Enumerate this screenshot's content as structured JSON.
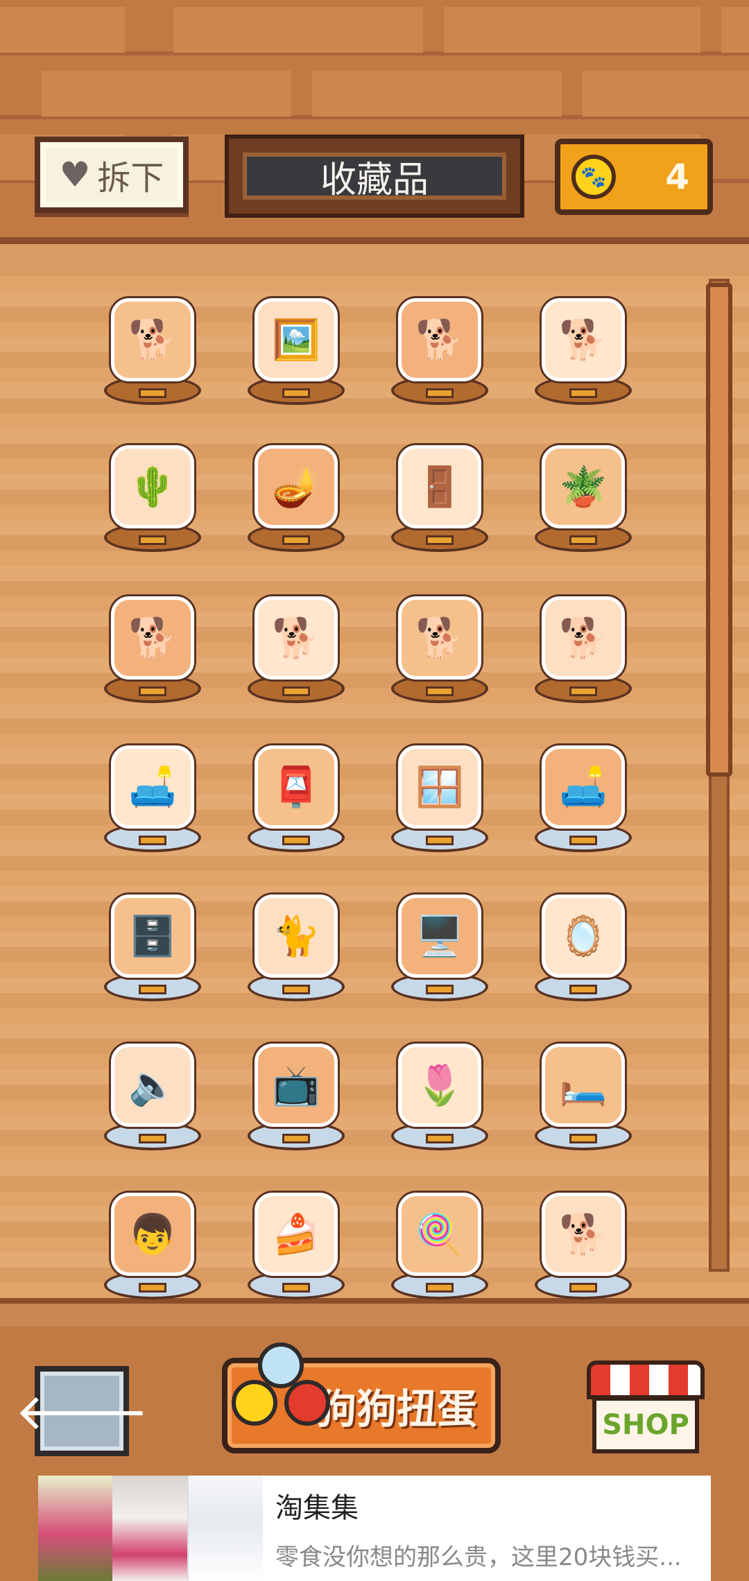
{
  "header": {
    "remove_label": "拆下",
    "title": "收藏品",
    "coin_count": "4"
  },
  "collection": {
    "rows": [
      [
        {
          "name": "shiba-figure",
          "icon": "🐕",
          "base": "wood"
        },
        {
          "name": "framed-cat-picture",
          "icon": "🖼️",
          "base": "wood"
        },
        {
          "name": "shiba-sitting",
          "icon": "🐕",
          "base": "wood"
        },
        {
          "name": "shiba-with-bowl",
          "icon": "🐕",
          "base": "wood"
        }
      ],
      [
        {
          "name": "shiba-with-cactus",
          "icon": "🌵",
          "base": "wood"
        },
        {
          "name": "floor-lamp",
          "icon": "🪔",
          "base": "wood"
        },
        {
          "name": "wardrobe",
          "icon": "🚪",
          "base": "wood"
        },
        {
          "name": "potted-plant-stool",
          "icon": "🪴",
          "base": "wood"
        }
      ],
      [
        {
          "name": "shiba-sleeping",
          "icon": "🐕",
          "base": "wood"
        },
        {
          "name": "shiba-with-hat",
          "icon": "🐕",
          "base": "wood"
        },
        {
          "name": "shiba-bow",
          "icon": "🐕",
          "base": "wood"
        },
        {
          "name": "shiba-with-box",
          "icon": "🐕",
          "base": "wood"
        }
      ],
      [
        {
          "name": "shiba-on-armchair",
          "icon": "🛋️",
          "base": "glass"
        },
        {
          "name": "shiba-with-mailbox",
          "icon": "📮",
          "base": "glass"
        },
        {
          "name": "round-window",
          "icon": "🪟",
          "base": "glass"
        },
        {
          "name": "shiba-on-sofa",
          "icon": "🛋️",
          "base": "glass"
        }
      ],
      [
        {
          "name": "tv-cabinet",
          "icon": "🗄️",
          "base": "glass"
        },
        {
          "name": "green-cat",
          "icon": "🐈",
          "base": "glass"
        },
        {
          "name": "computer-monitor",
          "icon": "🖥️",
          "base": "glass"
        },
        {
          "name": "oval-mirror",
          "icon": "🪞",
          "base": "glass"
        }
      ],
      [
        {
          "name": "shiba-with-speaker",
          "icon": "🔈",
          "base": "glass"
        },
        {
          "name": "television-stand",
          "icon": "📺",
          "base": "glass"
        },
        {
          "name": "shiba-with-planter",
          "icon": "🌷",
          "base": "glass"
        },
        {
          "name": "shiba-in-red-bed",
          "icon": "🛏️",
          "base": "glass"
        }
      ],
      [
        {
          "name": "boy-with-shiba",
          "icon": "👦",
          "base": "glass"
        },
        {
          "name": "table-with-cake",
          "icon": "🍰",
          "base": "glass"
        },
        {
          "name": "shiba-with-lollipop",
          "icon": "🍭",
          "base": "glass"
        },
        {
          "name": "shiba-with-gacha-balls",
          "icon": "🐕",
          "base": "glass"
        }
      ]
    ]
  },
  "footer": {
    "back_icon": "🡐",
    "gacha_label": "狗狗扭蛋",
    "shop_label": "SHOP"
  },
  "ad": {
    "title": "淘集集",
    "subtitle": "零食没你想的那么贵，这里20块钱买..."
  },
  "colors": {
    "wall": "#c27a45",
    "shelf": "#e0a46a",
    "coin": "#f1a11a",
    "gacha": "#e8782a"
  }
}
